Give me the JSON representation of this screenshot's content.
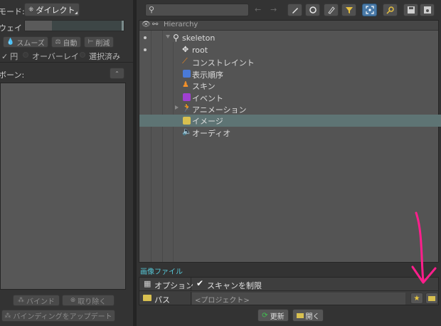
{
  "left_panel": {
    "mode_label": "モード:",
    "mode_value": "ダイレクト",
    "weight_label": "ウェイト:",
    "smooth_label": "スムーズ",
    "auto_label": "自動",
    "reduce_label": "削減",
    "circle_label": "円",
    "overlay_label": "オーバーレイ",
    "selected_label": "選択済み",
    "bones_label": "ボーン:",
    "bind_label": "バインド",
    "remove_label": "取り除く",
    "update_binding_label": "バインディングをアップデート"
  },
  "toolbar": {
    "search_placeholder": ""
  },
  "hierarchy": {
    "header_label": "Hierarchy",
    "items": [
      {
        "label": "skeleton",
        "icon": "skeleton-icon"
      },
      {
        "label": "root",
        "icon": "bone-icon"
      },
      {
        "label": "コンストレイント",
        "icon": "constraint-icon"
      },
      {
        "label": "表示順序",
        "icon": "draw-order-icon"
      },
      {
        "label": "スキン",
        "icon": "skin-icon"
      },
      {
        "label": "イベント",
        "icon": "event-icon"
      },
      {
        "label": "アニメーション",
        "icon": "animation-icon"
      },
      {
        "label": "イメージ",
        "icon": "image-folder-icon"
      },
      {
        "label": "オーディオ",
        "icon": "audio-icon"
      }
    ],
    "selected_index": 7
  },
  "properties": {
    "section_title": "画像ファイル",
    "options_label": "オプション",
    "scan_limit_label": "スキャンを制限",
    "scan_limit_checked": true,
    "path_label": "パス",
    "path_value": "<プロジェクト>"
  },
  "footer": {
    "update_label": "更新",
    "open_label": "開く"
  },
  "colors": {
    "selected_row": "#5e7474",
    "accent_teal": "#56c8d8",
    "annotation_arrow": "#ff1e8c"
  }
}
